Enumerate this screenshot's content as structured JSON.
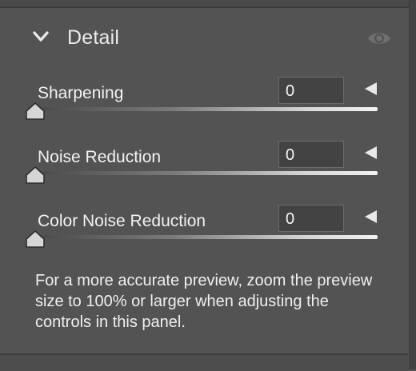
{
  "panel": {
    "title": "Detail",
    "collapse_icon": "chevron-down-icon",
    "visibility_icon": "eye-icon"
  },
  "sliders": [
    {
      "label": "Sharpening",
      "value": "0",
      "level": 0,
      "reset_icon": "reset-triangle-icon"
    },
    {
      "label": "Noise Reduction",
      "value": "0",
      "level": 0,
      "reset_icon": "reset-triangle-icon"
    },
    {
      "label": "Color Noise Reduction",
      "value": "0",
      "level": 0,
      "reset_icon": "reset-triangle-icon"
    }
  ],
  "info": {
    "text": "For a more accurate preview, zoom the preview size to 100% or larger when adjusting the controls in this panel."
  },
  "colors": {
    "panel_bg": "#535353",
    "text": "#f0f0f0",
    "input_bg": "#434343",
    "eye_icon": "#6f6f6f"
  }
}
